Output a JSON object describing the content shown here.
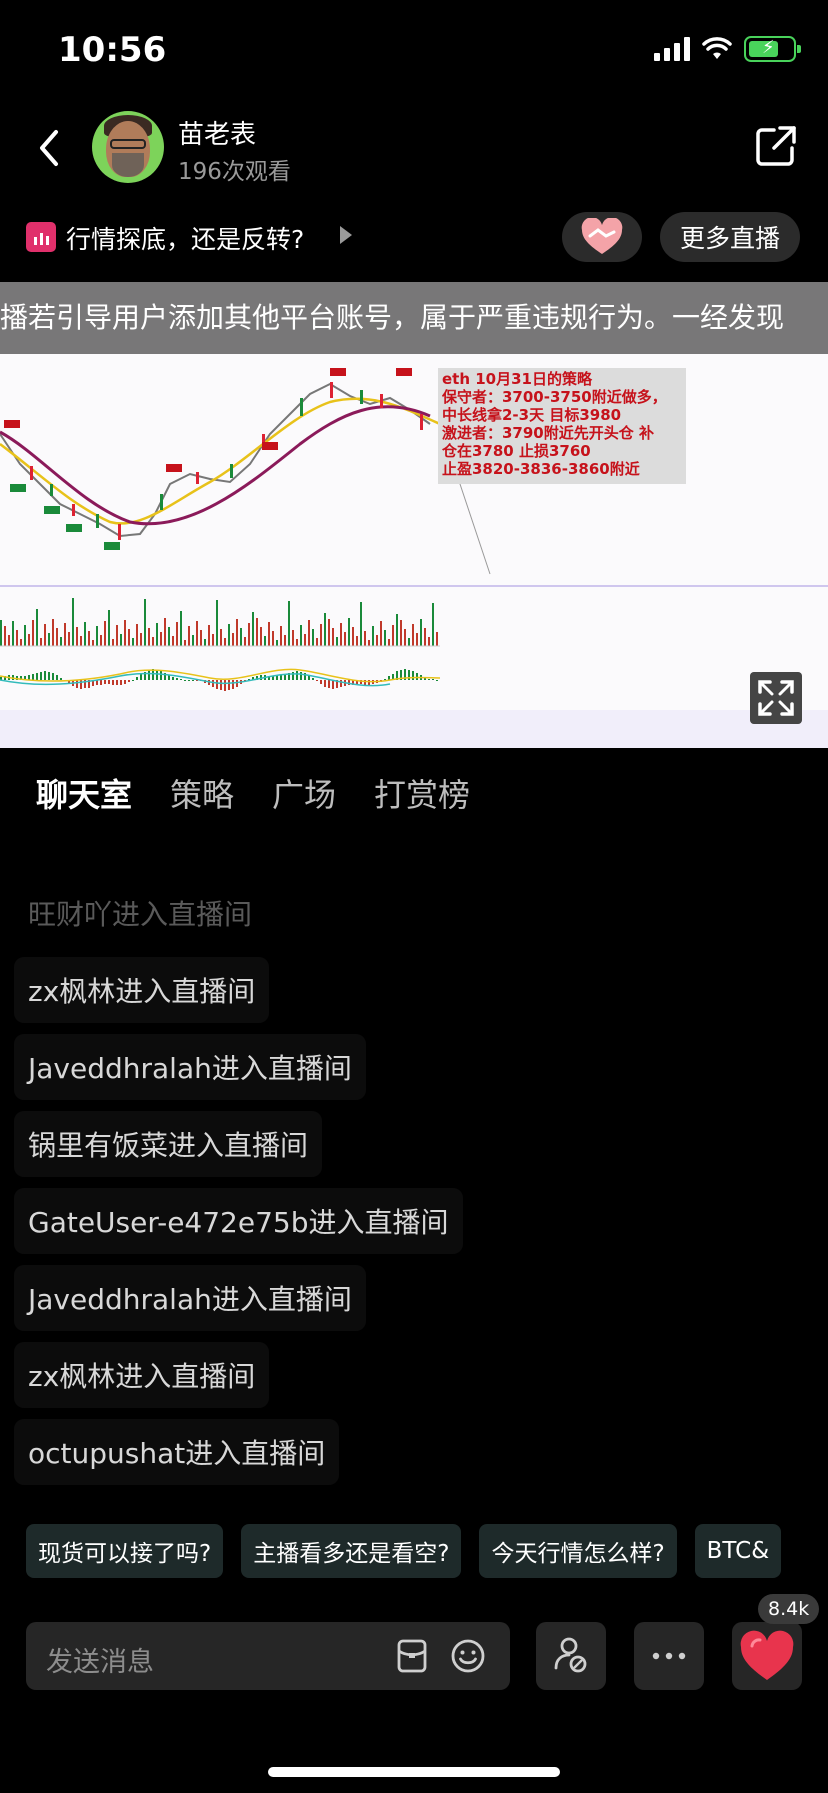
{
  "status_bar": {
    "time": "10:56"
  },
  "header": {
    "host_name": "苗老表",
    "view_count": "196次观看"
  },
  "topic": {
    "title": "行情探底，还是反转?"
  },
  "buttons": {
    "more_live": "更多直播"
  },
  "video": {
    "marquee_text": "播若引导用户添加其他平台账号，属于严重违规行为。一经发现",
    "strategy_lines": [
      "eth  10月31日的策略",
      "保守者：3700-3750附近做多，",
      "中长线拿2-3天  目标3980",
      "激进者：3790附近先开头仓  补",
      "仓在3780  止损3760",
      "止盈3820-3836-3860附近"
    ]
  },
  "tabs": [
    {
      "label": "聊天室",
      "active": true
    },
    {
      "label": "策略",
      "active": false
    },
    {
      "label": "广场",
      "active": false
    },
    {
      "label": "打赏榜",
      "active": false
    }
  ],
  "chat_messages": [
    "旺财吖进入直播间",
    "zx枫林进入直播间",
    "Javeddhralah进入直播间",
    "锅里有饭菜进入直播间",
    "GateUser-e472e75b进入直播间",
    "Javeddhralah进入直播间",
    "zx枫林进入直播间",
    "octupushat进入直播间"
  ],
  "quick_replies": [
    "现货可以接了吗?",
    "主播看多还是看空?",
    "今天行情怎么样?",
    "BTC&"
  ],
  "input": {
    "placeholder": "发送消息"
  },
  "like_count": "8.4k",
  "colors": {
    "accent_pink": "#e0306b",
    "battery_green": "#49d35b",
    "chip_bg": "#1e2a2a",
    "panel_bg": "#262626"
  }
}
